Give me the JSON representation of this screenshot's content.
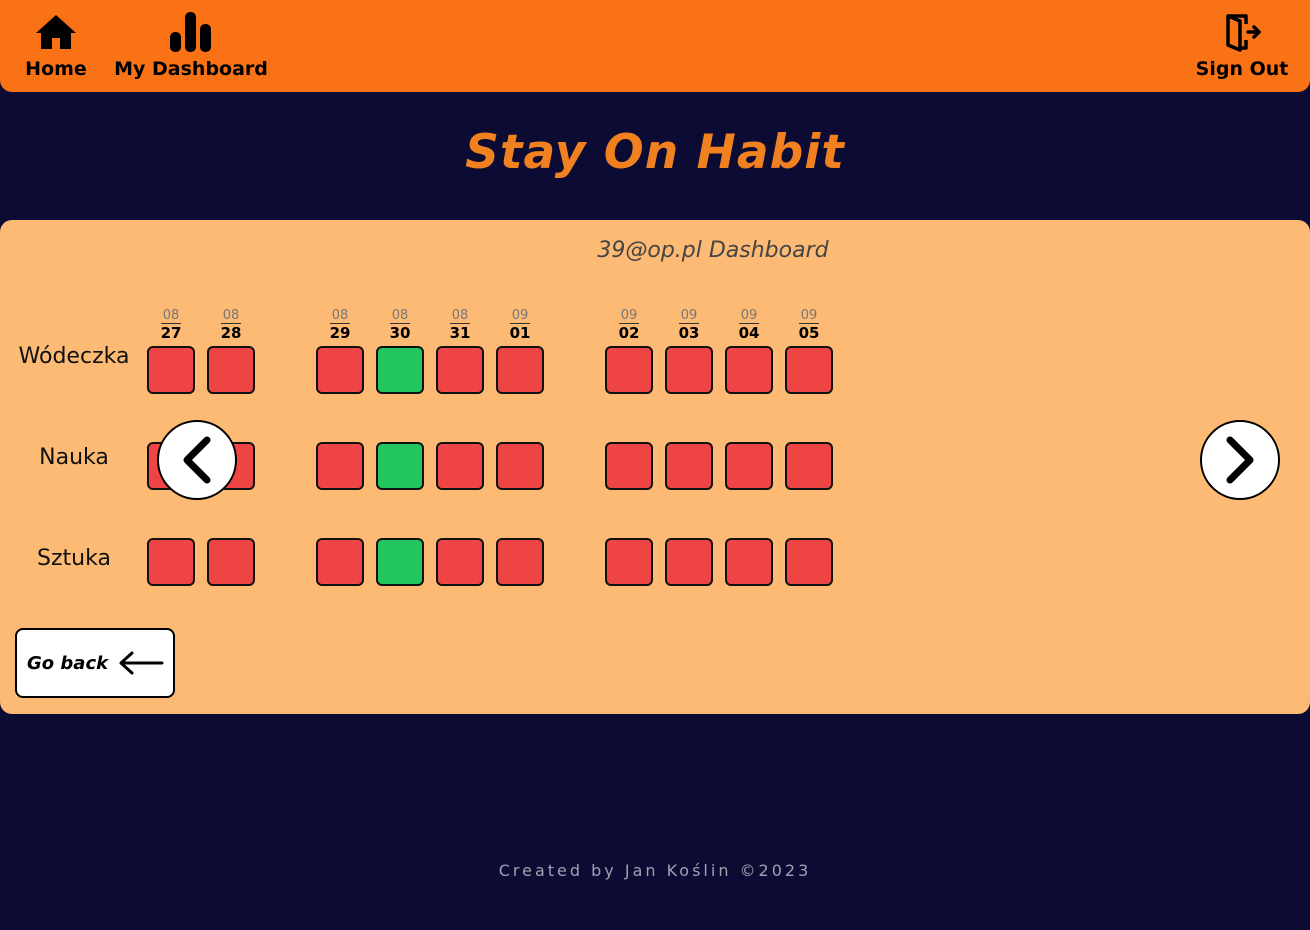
{
  "nav": {
    "home": {
      "label": "Home",
      "icon": "home-icon"
    },
    "dashboard": {
      "label": "My Dashboard",
      "icon": "bar-chart-icon"
    },
    "signout": {
      "label": "Sign Out",
      "icon": "sign-out-icon"
    }
  },
  "app_title": "Stay On Habit",
  "dashboard": {
    "title": "39@op.pl Dashboard",
    "dates": [
      {
        "month": "08",
        "day": "27"
      },
      {
        "month": "08",
        "day": "28"
      },
      {
        "month": "08",
        "day": "29"
      },
      {
        "month": "08",
        "day": "30"
      },
      {
        "month": "08",
        "day": "31"
      },
      {
        "month": "09",
        "day": "01"
      },
      {
        "month": "09",
        "day": "02"
      },
      {
        "month": "09",
        "day": "03"
      },
      {
        "month": "09",
        "day": "04"
      },
      {
        "month": "09",
        "day": "05"
      }
    ],
    "habits": [
      {
        "name": "Wódeczka",
        "status": [
          "miss",
          "miss",
          "miss",
          "done",
          "miss",
          "miss",
          "miss",
          "miss",
          "miss",
          "miss"
        ]
      },
      {
        "name": "Nauka",
        "status": [
          "miss",
          "miss",
          "miss",
          "done",
          "miss",
          "miss",
          "miss",
          "miss",
          "miss",
          "miss"
        ]
      },
      {
        "name": "Sztuka",
        "status": [
          "miss",
          "miss",
          "miss",
          "done",
          "miss",
          "miss",
          "miss",
          "miss",
          "miss",
          "miss"
        ]
      }
    ],
    "prev_icon": "chevron-left-icon",
    "next_icon": "chevron-right-icon",
    "go_back": {
      "label": "Go back",
      "icon": "arrow-left-icon"
    }
  },
  "colors": {
    "navbar": "#f97316",
    "background": "#0b0b33",
    "panel": "#fdba74",
    "title": "#f08020",
    "done": "#22c55e",
    "miss": "#ef4444"
  },
  "footer": "Created by Jan Koślin ©2023"
}
